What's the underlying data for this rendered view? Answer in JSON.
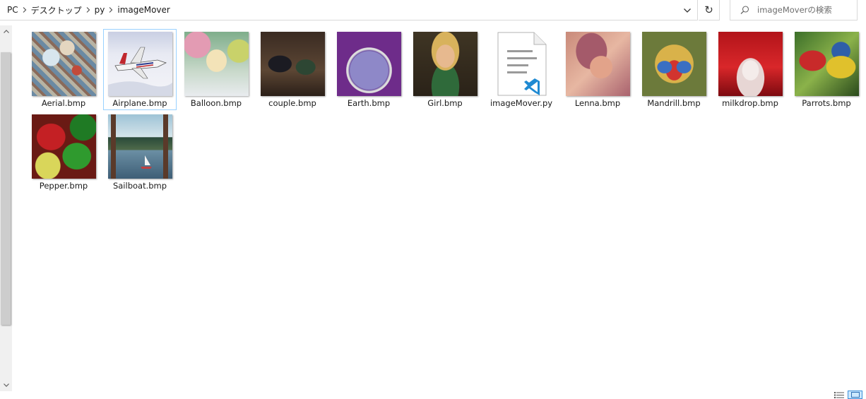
{
  "breadcrumb": [
    "PC",
    "デスクトップ",
    "py",
    "imageMover"
  ],
  "search": {
    "placeholder": "imageMoverの検索"
  },
  "files": [
    {
      "name": "Aerial.bmp",
      "thumb": "aerial"
    },
    {
      "name": "Airplane.bmp",
      "thumb": "airplane",
      "selected": true
    },
    {
      "name": "Balloon.bmp",
      "thumb": "balloon"
    },
    {
      "name": "couple.bmp",
      "thumb": "couple"
    },
    {
      "name": "Earth.bmp",
      "thumb": "earth"
    },
    {
      "name": "Girl.bmp",
      "thumb": "girl"
    },
    {
      "name": "imageMover.py",
      "thumb": "py-file-icon"
    },
    {
      "name": "Lenna.bmp",
      "thumb": "lenna"
    },
    {
      "name": "Mandrill.bmp",
      "thumb": "mandrill"
    },
    {
      "name": "milkdrop.bmp",
      "thumb": "milkdrop"
    },
    {
      "name": "Parrots.bmp",
      "thumb": "parrots"
    },
    {
      "name": "Pepper.bmp",
      "thumb": "pepper"
    },
    {
      "name": "Sailboat.bmp",
      "thumb": "sailboat"
    }
  ],
  "colors": {
    "selection_border": "#99d1ff",
    "vscode_blue": "#1f8ad2"
  },
  "icons": {
    "refresh": "↻",
    "search": "search-icon",
    "dropdown": "chevron-down-icon"
  }
}
